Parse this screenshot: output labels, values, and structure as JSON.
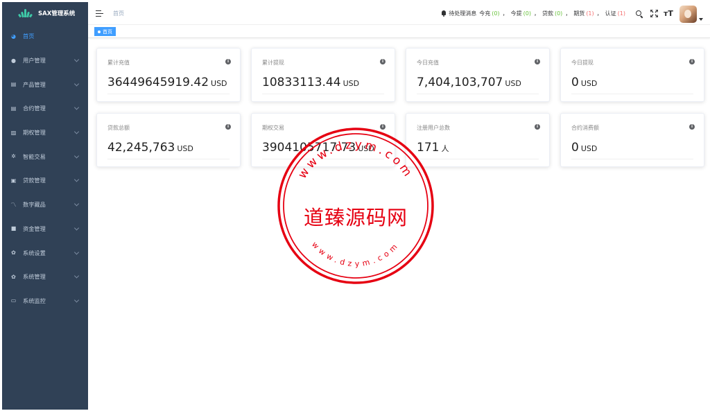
{
  "sidebar": {
    "logo_title": "SAX管理系统",
    "items": [
      {
        "label": "首页",
        "icon": "dashboard-icon",
        "active": true
      },
      {
        "label": "用户管理",
        "icon": "users-icon"
      },
      {
        "label": "产品管理",
        "icon": "document-icon"
      },
      {
        "label": "合约管理",
        "icon": "document-icon"
      },
      {
        "label": "期权管理",
        "icon": "chart-icon"
      },
      {
        "label": "智能交易",
        "icon": "gear-icon"
      },
      {
        "label": "贷款管理",
        "icon": "loan-icon"
      },
      {
        "label": "数字藏品",
        "icon": "trend-icon"
      },
      {
        "label": "资金管理",
        "icon": "wallet-icon"
      },
      {
        "label": "系统设置",
        "icon": "gear-icon"
      },
      {
        "label": "系统管理",
        "icon": "gear-icon"
      },
      {
        "label": "系统监控",
        "icon": "monitor-icon"
      }
    ]
  },
  "header": {
    "breadcrumb": "首页",
    "notice": {
      "label": "待处理消息",
      "recharge_label": "今充",
      "recharge_count": "(0)",
      "withdraw_label": "今提",
      "withdraw_count": "(0)",
      "loan_label": "贷款",
      "loan_count": "(0)",
      "option_label": "期货",
      "option_count": "(1)",
      "verify_label": "认证",
      "verify_count": "(1)",
      "comma": "，"
    },
    "tools": [
      "search-icon",
      "fullscreen-icon",
      "font-size-icon"
    ],
    "font_size_glyph": "ᴛT"
  },
  "tags": {
    "active": "首页"
  },
  "cards": [
    {
      "title": "累计充值",
      "value": "36449645919.42",
      "unit": "USD"
    },
    {
      "title": "累计提现",
      "value": "10833113.44",
      "unit": "USD"
    },
    {
      "title": "今日充值",
      "value": "7,404,103,707",
      "unit": "USD"
    },
    {
      "title": "今日提现",
      "value": "0",
      "unit": "USD"
    },
    {
      "title": "贷款总额",
      "value": "42,245,763",
      "unit": "USD"
    },
    {
      "title": "期权交易",
      "value": "3904105717.73",
      "unit": "USD"
    },
    {
      "title": "注册用户总数",
      "value": "171",
      "unit": "人"
    },
    {
      "title": "合约消费额",
      "value": "0",
      "unit": "USD"
    }
  ],
  "info_glyph": "i",
  "watermark": {
    "center_text": "道臻源码网",
    "ring_top": "www.dzym.com",
    "ring_bottom": "www.dzym.com"
  }
}
